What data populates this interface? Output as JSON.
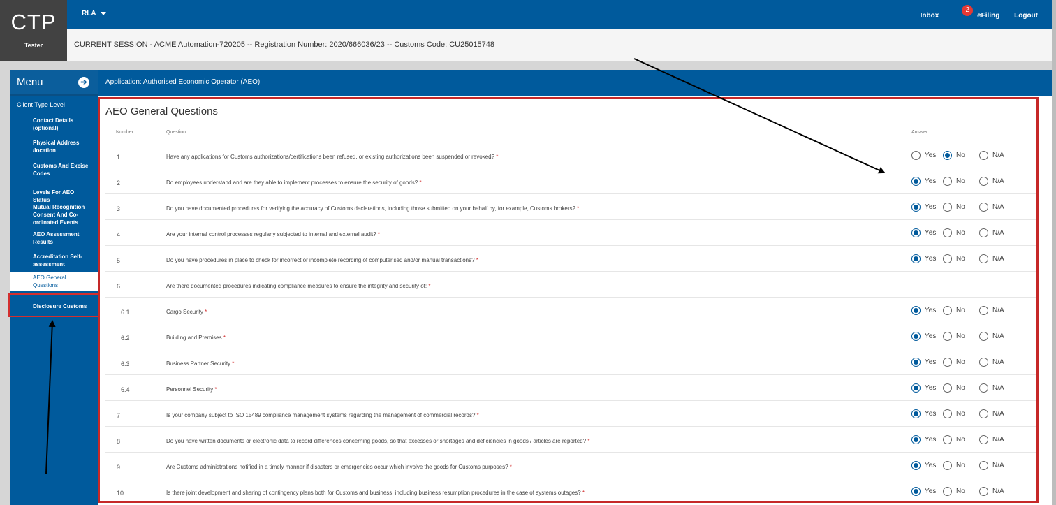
{
  "header": {
    "logo": "CTP",
    "user": "Tester",
    "role_menu": "RLA",
    "links": [
      "Inbox",
      "eFiling",
      "Logout"
    ],
    "inbox_badge": "2"
  },
  "session": {
    "text": "CURRENT SESSION - ACME Automation-720205 -- Registration Number: 2020/666036/23 -- Customs Code: CU25015748"
  },
  "sidebar": {
    "title": "Menu",
    "section": "Client Type Level",
    "items": [
      {
        "label": "Contact Details (optional)",
        "active": false
      },
      {
        "label": "Physical Address /location",
        "active": false
      },
      {
        "label": "Customs And Excise Codes",
        "active": false
      },
      {
        "label": "Levels For AEO Status",
        "active": false
      },
      {
        "label": "Mutual Recognition Consent And Co-ordinated Events",
        "active": false
      },
      {
        "label": "AEO Assessment Results",
        "active": false
      },
      {
        "label": "Accreditation Self-assessment",
        "active": false
      },
      {
        "label": "AEO General Questions",
        "active": true
      },
      {
        "label": "Disclosure Customs",
        "active": false
      }
    ]
  },
  "application": {
    "title": "Application: Authorised Economic Operator (AEO)"
  },
  "questions": {
    "title": "AEO General Questions",
    "columns": {
      "number": "Number",
      "question": "Question",
      "answer": "Answer"
    },
    "options": [
      "Yes",
      "No",
      "N/A"
    ],
    "required_mark": "*",
    "rows": [
      {
        "number": "1",
        "text": "Have any applications for Customs authorizations/certifications been refused, or existing authorizations been suspended or revoked?",
        "answer": "No"
      },
      {
        "number": "2",
        "text": "Do employees understand and are they able to implement processes to ensure the security of goods?",
        "answer": "Yes"
      },
      {
        "number": "3",
        "text": "Do you have documented procedures for verifying the accuracy of Customs declarations, including those submitted on your behalf by, for example, Customs brokers?",
        "answer": "Yes"
      },
      {
        "number": "4",
        "text": "Are your internal control processes regularly subjected to internal and external audit?",
        "answer": "Yes"
      },
      {
        "number": "5",
        "text": "Do you have procedures in place to check for incorrect or incomplete recording of computerised and/or manual transactions?",
        "answer": "Yes"
      },
      {
        "number": "6",
        "text": "Are there documented procedures indicating compliance measures to ensure the integrity and security of:",
        "answer": null
      },
      {
        "number": "6.1",
        "text": "Cargo Security",
        "answer": "Yes"
      },
      {
        "number": "6.2",
        "text": "Building and Premises",
        "answer": "Yes"
      },
      {
        "number": "6.3",
        "text": "Business Partner Security",
        "answer": "Yes"
      },
      {
        "number": "6.4",
        "text": "Personnel Security",
        "answer": "Yes"
      },
      {
        "number": "7",
        "text": "Is your company subject to ISO 15489 compliance management systems regarding the management of commercial records?",
        "answer": "Yes"
      },
      {
        "number": "8",
        "text": "Do you have written documents or electronic data to record differences concerning goods, so that excesses or shortages and deficiencies in goods / articles are reported?",
        "answer": "Yes"
      },
      {
        "number": "9",
        "text": "Are Customs administrations notified in a timely manner if disasters or emergencies occur which involve the goods for Customs purposes?",
        "answer": "Yes"
      },
      {
        "number": "10",
        "text": "Is there joint development and sharing of contingency plans both for Customs and business, including business resumption procedures in the case of systems outages?",
        "answer": "Yes"
      }
    ]
  },
  "colors": {
    "brand": "#005a9c",
    "logo_bg": "#424242",
    "highlight": "#c62828",
    "badge": "#e53935"
  }
}
